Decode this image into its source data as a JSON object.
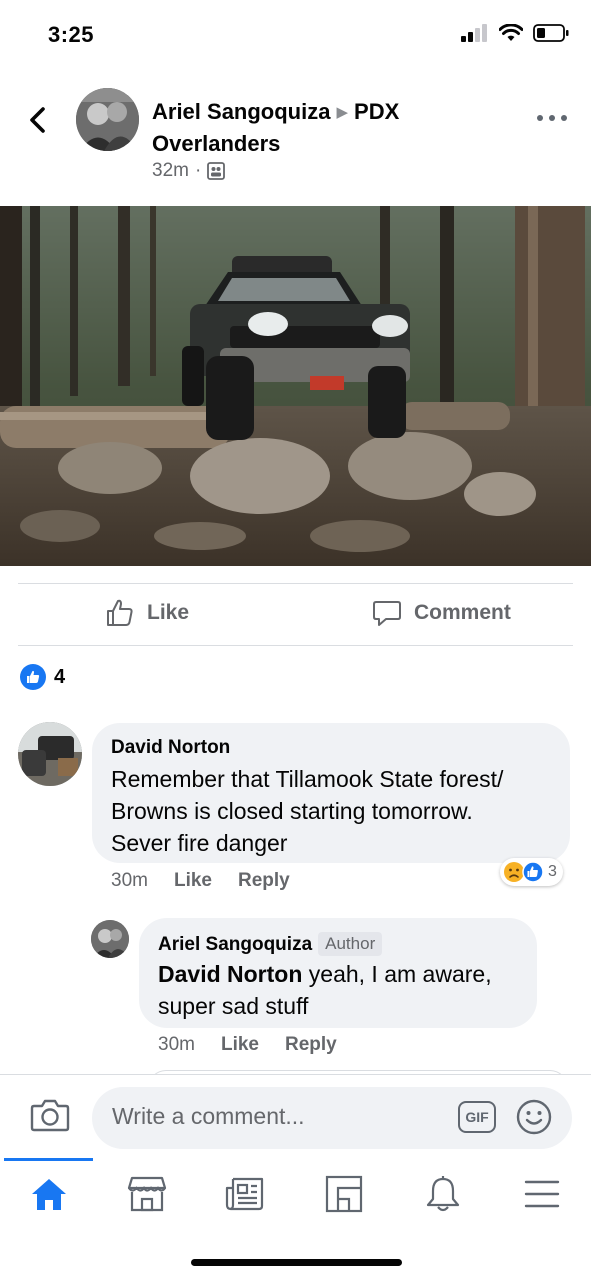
{
  "status_bar": {
    "time": "3:25"
  },
  "header": {
    "author": "Ariel Sangoquiza",
    "group_line1": "PDX",
    "group_line2": "Overlanders",
    "timestamp": "32m",
    "separator": "·"
  },
  "actions": {
    "like_label": "Like",
    "comment_label": "Comment"
  },
  "reactions": {
    "count": "4"
  },
  "comments": [
    {
      "name": "David Norton",
      "text_line1": "Remember that Tillamook State forest/",
      "text_line2": "Browns is closed starting tomorrow.",
      "text_line3": "Sever fire danger",
      "time": "30m",
      "like": "Like",
      "reply": "Reply",
      "reaction_count": "3"
    }
  ],
  "reply": {
    "name": "Ariel Sangoquiza",
    "badge": "Author",
    "mention": "David Norton",
    "text_line1": " yeah, I am aware,",
    "text_line2": "super sad stuff",
    "time": "30m",
    "like": "Like",
    "reply": "Reply"
  },
  "compose": {
    "placeholder": "Write a comment...",
    "gif_label": "GIF"
  },
  "colors": {
    "accent": "#1877f2",
    "bubble": "#f0f2f5",
    "secondary_text": "#65676b"
  },
  "tabs": [
    "home-icon",
    "marketplace-icon",
    "news-icon",
    "groups-icon",
    "notifications-icon",
    "menu-icon"
  ]
}
